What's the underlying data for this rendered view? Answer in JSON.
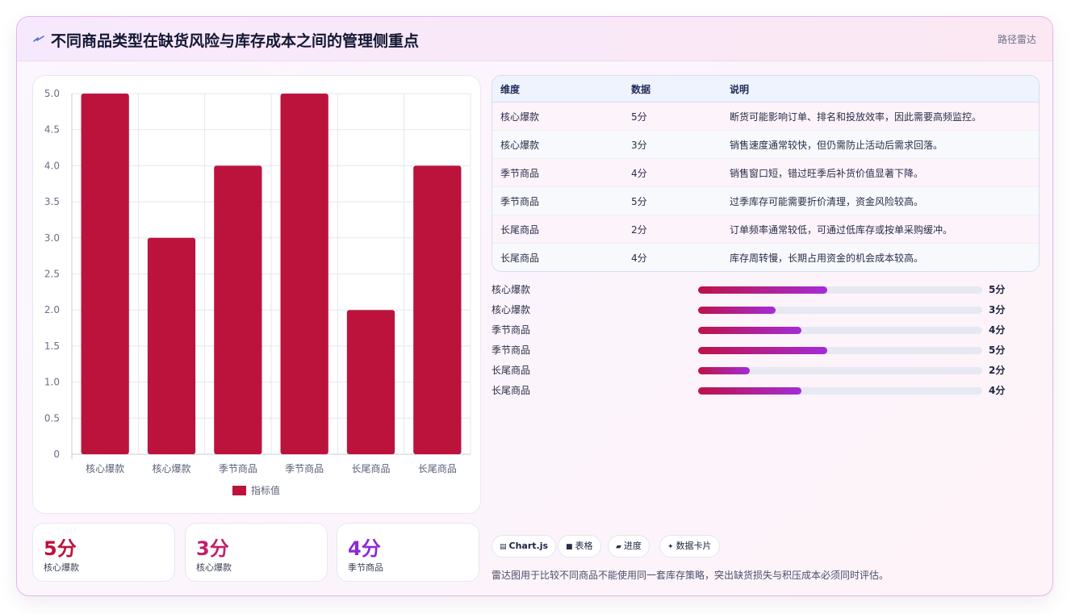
{
  "header": {
    "title": "不同商品类型在缺货风险与库存成本之间的管理侧重点",
    "tag": "路径雷达"
  },
  "chart_data": {
    "type": "bar",
    "categories": [
      "核心爆款",
      "核心爆款",
      "季节商品",
      "季节商品",
      "长尾商品",
      "长尾商品"
    ],
    "series": [
      {
        "name": "指标值",
        "values": [
          5,
          3,
          4,
          5,
          2,
          4
        ]
      }
    ],
    "ylim": [
      0,
      5
    ],
    "yticks": [
      "0",
      "0.5",
      "1.0",
      "1.5",
      "2.0",
      "2.5",
      "3.0",
      "3.5",
      "4.0",
      "4.5",
      "5.0"
    ],
    "grid": true,
    "legend": "bottom",
    "color": "#bc133d"
  },
  "table": {
    "headers": [
      "维度",
      "数据",
      "说明"
    ],
    "rows": [
      [
        "核心爆款",
        "5分",
        "断货可能影响订单、排名和投放效率，因此需要高频监控。"
      ],
      [
        "核心爆款",
        "3分",
        "销售速度通常较快，但仍需防止活动后需求回落。"
      ],
      [
        "季节商品",
        "4分",
        "销售窗口短，错过旺季后补货价值显著下降。"
      ],
      [
        "季节商品",
        "5分",
        "过季库存可能需要折价清理，资金风险较高。"
      ],
      [
        "长尾商品",
        "2分",
        "订单频率通常较低，可通过低库存或按单采购缓冲。"
      ],
      [
        "长尾商品",
        "4分",
        "库存周转慢，长期占用资金的机会成本较高。"
      ]
    ]
  },
  "progress": [
    {
      "label": "核心爆款",
      "value": "5分",
      "score": 5
    },
    {
      "label": "核心爆款",
      "value": "3分",
      "score": 3
    },
    {
      "label": "季节商品",
      "value": "4分",
      "score": 4
    },
    {
      "label": "季节商品",
      "value": "5分",
      "score": 5
    },
    {
      "label": "长尾商品",
      "value": "2分",
      "score": 2
    },
    {
      "label": "长尾商品",
      "value": "4分",
      "score": 4
    }
  ],
  "progress_max": 11,
  "stats": [
    {
      "value": "5分",
      "label": "核心爆款",
      "color": "#bc133d"
    },
    {
      "value": "3分",
      "label": "核心爆款",
      "color": "#c2206a"
    },
    {
      "value": "4分",
      "label": "季节商品",
      "color": "#8b2ad6"
    }
  ],
  "chips": [
    "Chart.js",
    "表格",
    "进度",
    "数据卡片"
  ],
  "chip_icons": [
    "chart-icon",
    "table-icon",
    "progress-icon",
    "card-icon"
  ],
  "note": "雷达图用于比较不同商品不能使用同一套库存策略，突出缺货损失与积压成本必须同时评估。"
}
